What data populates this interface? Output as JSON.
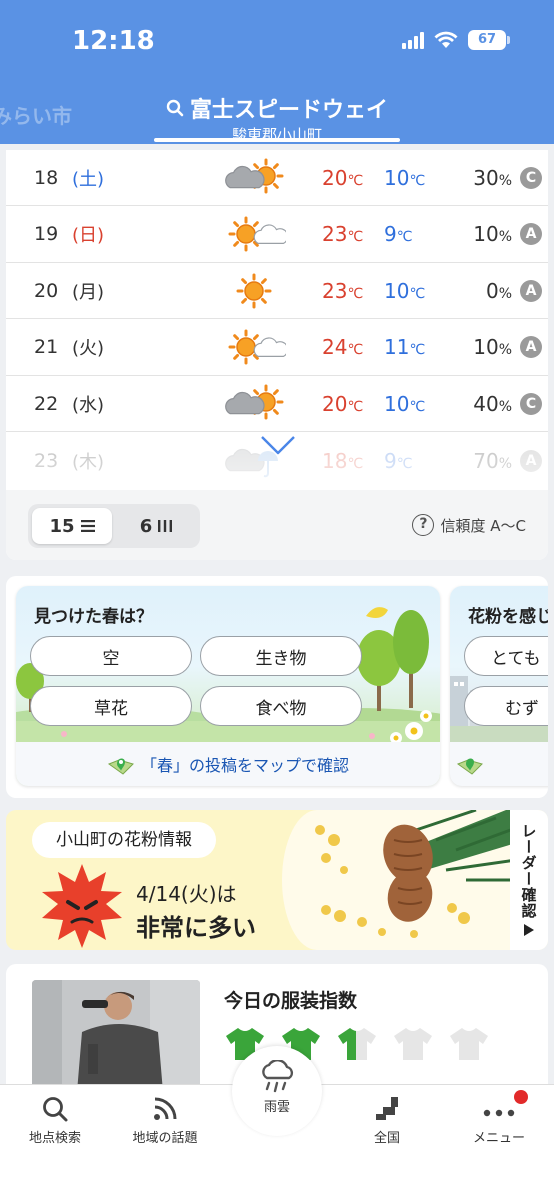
{
  "status_bar": {
    "time": "12:18",
    "battery": "67"
  },
  "header": {
    "prev_location": "みらい市",
    "location_name": "富士スピードウェイ",
    "location_sub": "駿東郡小山町"
  },
  "forecast": {
    "unit": "℃",
    "rows": [
      {
        "day": "18",
        "weekday": "(土)",
        "weekday_type": "sat",
        "weather": "cloudy-sunny",
        "high": "20",
        "low": "10",
        "precip": "30",
        "precip_unit": "%",
        "reliability": "C"
      },
      {
        "day": "19",
        "weekday": "(日)",
        "weekday_type": "sun",
        "weather": "sunny-cloudy",
        "high": "23",
        "low": "9",
        "precip": "10",
        "precip_unit": "%",
        "reliability": "A"
      },
      {
        "day": "20",
        "weekday": "(月)",
        "weekday_type": "weekday",
        "weather": "sunny",
        "high": "23",
        "low": "10",
        "precip": "0",
        "precip_unit": "%",
        "reliability": "A"
      },
      {
        "day": "21",
        "weekday": "(火)",
        "weekday_type": "weekday",
        "weather": "sunny-cloudy",
        "high": "24",
        "low": "11",
        "precip": "10",
        "precip_unit": "%",
        "reliability": "A"
      },
      {
        "day": "22",
        "weekday": "(水)",
        "weekday_type": "weekday",
        "weather": "cloudy-sunny",
        "high": "20",
        "low": "10",
        "precip": "40",
        "precip_unit": "%",
        "reliability": "C"
      },
      {
        "day": "23",
        "weekday": "(木)",
        "weekday_type": "weekday",
        "weather": "cloudy-rain",
        "high": "18",
        "low": "9",
        "precip": "70",
        "precip_unit": "%",
        "reliability": "A"
      }
    ],
    "toggle": {
      "option_15": "15",
      "option_6": "6"
    },
    "reliability_label": "信頼度 A〜C"
  },
  "spring_card": {
    "title": "見つけた春は？",
    "options": [
      "空",
      "生き物",
      "草花",
      "食べ物"
    ],
    "footer_link": "「春」の投稿をマップで確認"
  },
  "pollen_card": {
    "title": "花粉を感じ",
    "options": [
      "とても",
      "むず"
    ]
  },
  "pollen_info": {
    "tag": "小山町の花粉情報",
    "date": "4/14(火)は",
    "level": "非常に多い",
    "radar_label": "レーダー確認",
    "colors": {
      "level_badge": "#e8402b"
    }
  },
  "clothing": {
    "title": "今日の服装指数"
  },
  "bottom_nav": {
    "search": "地点検索",
    "topics": "地域の話題",
    "rain": "雨雲",
    "nationwide": "全国",
    "menu": "メニュー"
  },
  "colors": {
    "header": "#5a92e4",
    "high_temp": "#d9412f",
    "low_temp": "#2f6fdc"
  }
}
